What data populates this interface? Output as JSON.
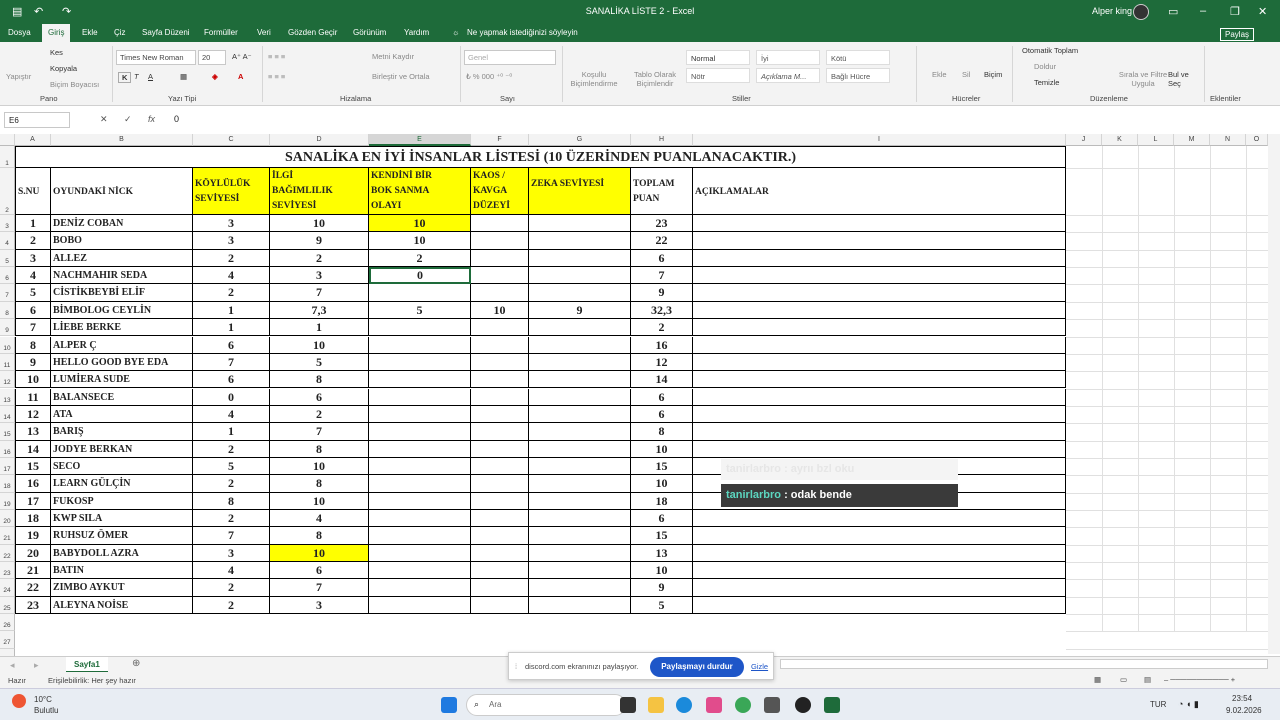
{
  "window": {
    "title": "SANALİKA LİSTE 2  -  Excel",
    "user": "Alper king",
    "share": "Paylaş"
  },
  "menu": [
    "Dosya",
    "Giriş",
    "Ekle",
    "Çiz",
    "Sayfa Düzeni",
    "Formüller",
    "Veri",
    "Gözden Geçir",
    "Görünüm",
    "Yardım",
    "Ne yapmak istediğinizi söyleyin"
  ],
  "ribbon": {
    "groups": [
      "Pano",
      "Yazı Tipi",
      "Hizalama",
      "Sayı",
      "Stiller",
      "Hücreler",
      "Düzenleme",
      "Eklentiler"
    ],
    "font": "Times New Roman",
    "size": "20",
    "clipboard": [
      "Yapıştır",
      "Kes",
      "Kopyala",
      "Biçim Boyacısı"
    ],
    "align": [
      "Metni Kaydır",
      "Birleştir ve Ortala"
    ],
    "number_format": "Genel",
    "styles": [
      "Normal",
      "İyi",
      "Kötü",
      "Nötr",
      "Açıklama M...",
      "Bağlı Hücre"
    ],
    "cond": [
      "Koşullu Biçimlendirme",
      "Tablo Olarak Biçimlendir"
    ],
    "cells": [
      "Ekle",
      "Sil",
      "Biçim"
    ],
    "edit": [
      "Otomatik Toplam",
      "Doldur",
      "Temizle",
      "Sırala ve Filtre Uygula",
      "Bul ve Seç"
    ]
  },
  "formula": {
    "name_box": "E6",
    "value": "0"
  },
  "columns": [
    "A",
    "B",
    "C",
    "D",
    "E",
    "F",
    "G",
    "H",
    "I",
    "J",
    "K",
    "L",
    "M",
    "N",
    "O"
  ],
  "sheet": {
    "title": "SANALİKA EN İYİ İNSANLAR LİSTESİ  (10 ÜZERİNDEN PUANLANACAKTIR.)",
    "headers": [
      "S.NU",
      "OYUNDAKİ NİCK",
      "KÖYLÜLÜK SEVİYESİ",
      "İLGİ BAĞIMLILIK SEVİYESİ",
      "KENDİNİ BİR BOK SANMA OLAYI",
      "KAOS / KAVGA DÜZEYİ",
      "ZEKA SEVİYESİ",
      "TOPLAM PUAN",
      "AÇIKLAMALAR"
    ],
    "rows": [
      [
        "1",
        "DENİZ COBAN",
        "3",
        "10",
        "10",
        "",
        "",
        "23"
      ],
      [
        "2",
        "BOBO",
        "3",
        "9",
        "10",
        "",
        "",
        "22"
      ],
      [
        "3",
        "ALLEZ",
        "2",
        "2",
        "2",
        "",
        "",
        "6"
      ],
      [
        "4",
        "NACHMAHIR SEDA",
        "4",
        "3",
        "0",
        "",
        "",
        "7"
      ],
      [
        "5",
        "CİSTİKBEYBİ ELİF",
        "2",
        "7",
        "",
        "",
        "",
        "9"
      ],
      [
        "6",
        "BİMBOLOG CEYLİN",
        "1",
        "7,3",
        "5",
        "10",
        "9",
        "32,3"
      ],
      [
        "7",
        "LİEBE BERKE",
        "1",
        "1",
        "",
        "",
        "",
        "2"
      ],
      [
        "8",
        "ALPER Ç",
        "6",
        "10",
        "",
        "",
        "",
        "16"
      ],
      [
        "9",
        "HELLO GOOD BYE EDA",
        "7",
        "5",
        "",
        "",
        "",
        "12"
      ],
      [
        "10",
        "LUMİERA SUDE",
        "6",
        "8",
        "",
        "",
        "",
        "14"
      ],
      [
        "11",
        "BALANSECE",
        "0",
        "6",
        "",
        "",
        "",
        "6"
      ],
      [
        "12",
        "ATA",
        "4",
        "2",
        "",
        "",
        "",
        "6"
      ],
      [
        "13",
        "BARIŞ",
        "1",
        "7",
        "",
        "",
        "",
        "8"
      ],
      [
        "14",
        "JODYE BERKAN",
        "2",
        "8",
        "",
        "",
        "",
        "10"
      ],
      [
        "15",
        "SECO",
        "5",
        "10",
        "",
        "",
        "",
        "15"
      ],
      [
        "16",
        "LEARN GÜLÇİN",
        "2",
        "8",
        "",
        "",
        "",
        "10"
      ],
      [
        "17",
        "FUKOSP",
        "8",
        "10",
        "",
        "",
        "",
        "18"
      ],
      [
        "18",
        "KWP SILA",
        "2",
        "4",
        "",
        "",
        "",
        "6"
      ],
      [
        "19",
        "RUHSUZ ÖMER",
        "7",
        "8",
        "",
        "",
        "",
        "15"
      ],
      [
        "20",
        "BABYDOLL AZRA",
        "3",
        "10",
        "",
        "",
        "",
        "13"
      ],
      [
        "21",
        "BATIN",
        "4",
        "6",
        "",
        "",
        "",
        "10"
      ],
      [
        "22",
        "ZIMBO AYKUT",
        "2",
        "7",
        "",
        "",
        "",
        "9"
      ],
      [
        "23",
        "ALEYNA NOİSE",
        "2",
        "3",
        "",
        "",
        "",
        "5"
      ]
    ]
  },
  "chat": {
    "faint_user": "tanirlarbro",
    "faint_msg": " : ayrıı bzl oku",
    "user": "tanirlarbro",
    "msg": " : odak bende"
  },
  "sheetbar": {
    "tab": "Sayfa1"
  },
  "status": {
    "ready": "Hazır",
    "access": "Erişilebilirlik: Her şey hazır"
  },
  "discord": {
    "text": "discord.com ekranınızı paylaşıyor.",
    "button": "Paylaşmayı durdur",
    "hide": "Gizle"
  },
  "taskbar": {
    "weather": "10°C",
    "weather2": "Bulutlu",
    "search": "Ara",
    "lang": "TUR",
    "time": "23:54",
    "date": "9.02.2026"
  }
}
